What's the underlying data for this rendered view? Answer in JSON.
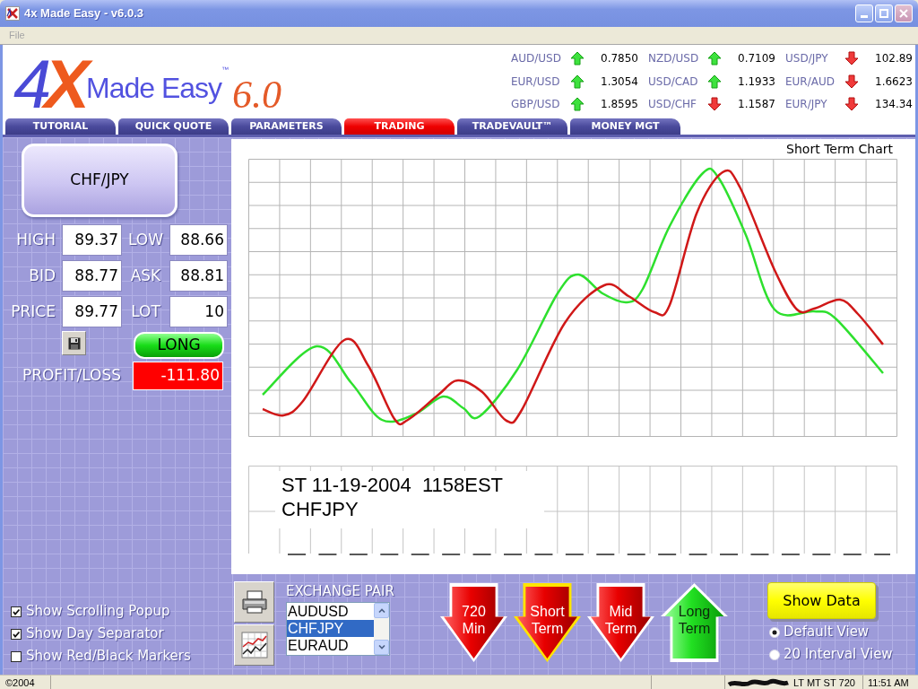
{
  "window": {
    "title": "4x Made Easy - v6.0.3"
  },
  "menu": [
    {
      "label": "File",
      "disabled": true
    }
  ],
  "logo": {
    "numeral": "4",
    "letter": "X",
    "name": "Made Easy",
    "trademark": "™",
    "version": "6.0"
  },
  "quotes": [
    {
      "pair": "AUD/USD",
      "rising": true,
      "value": "0.7850"
    },
    {
      "pair": "NZD/USD",
      "rising": true,
      "value": "0.7109"
    },
    {
      "pair": "USD/JPY",
      "rising": false,
      "value": "102.89"
    },
    {
      "pair": "EUR/USD",
      "rising": true,
      "value": "1.3054"
    },
    {
      "pair": "USD/CAD",
      "rising": true,
      "value": "1.1933"
    },
    {
      "pair": "EUR/AUD",
      "rising": false,
      "value": "1.6623"
    },
    {
      "pair": "GBP/USD",
      "rising": true,
      "value": "1.8595"
    },
    {
      "pair": "USD/CHF",
      "rising": false,
      "value": "1.1587"
    },
    {
      "pair": "EUR/JPY",
      "rising": false,
      "value": "134.34"
    }
  ],
  "tabs": [
    {
      "label": "TUTORIAL",
      "selected": false
    },
    {
      "label": "QUICK QUOTE",
      "selected": false
    },
    {
      "label": "PARAMETERS",
      "selected": false
    },
    {
      "label": "TRADING",
      "selected": true
    },
    {
      "label": "TRADEVAULT™",
      "selected": false
    },
    {
      "label": "MONEY MGT",
      "selected": false
    }
  ],
  "pair_button": {
    "label": "CHF/JPY"
  },
  "stats": [
    {
      "label": "HIGH",
      "value": "89.37"
    },
    {
      "label": "LOW",
      "value": "88.66"
    },
    {
      "label": "BID",
      "value": "88.77"
    },
    {
      "label": "ASK",
      "value": "88.81"
    },
    {
      "label": "PRICE",
      "value": "89.77"
    },
    {
      "label": "LOT",
      "value": "10"
    }
  ],
  "position_button": {
    "label": "LONG"
  },
  "profit_loss": {
    "label": "PROFIT/LOSS",
    "value": "-111.80"
  },
  "options": [
    {
      "label": "Show Scrolling Popup",
      "checked": true
    },
    {
      "label": "Show Day Separator",
      "checked": true
    },
    {
      "label": "Show Red/Black Markers",
      "checked": false
    }
  ],
  "exchange_pair": {
    "label": "EXCHANGE PAIR",
    "items": [
      {
        "label": "AUDUSD",
        "selected": false
      },
      {
        "label": "CHFJPY",
        "selected": true
      },
      {
        "label": "EURAUD",
        "selected": false
      }
    ]
  },
  "timeframes": [
    {
      "label": "720 Min",
      "rising": false,
      "selected": false
    },
    {
      "label": "Short Term",
      "rising": false,
      "selected": true
    },
    {
      "label": "Mid Term",
      "rising": false,
      "selected": false
    },
    {
      "label": "Long Term",
      "rising": true,
      "selected": false
    }
  ],
  "show_data_button": {
    "label": "Show Data"
  },
  "views": [
    {
      "label": "Default View",
      "selected": true
    },
    {
      "label": "20 Interval View",
      "selected": false
    }
  ],
  "chart": {
    "title": "Short Term Chart",
    "caption": [
      "ST 11-19-2004  1158EST",
      "CHFJPY"
    ]
  },
  "status_bar": {
    "copyright": "©2004",
    "indicators": "LT MT ST 720",
    "time": "11:51 AM"
  }
}
